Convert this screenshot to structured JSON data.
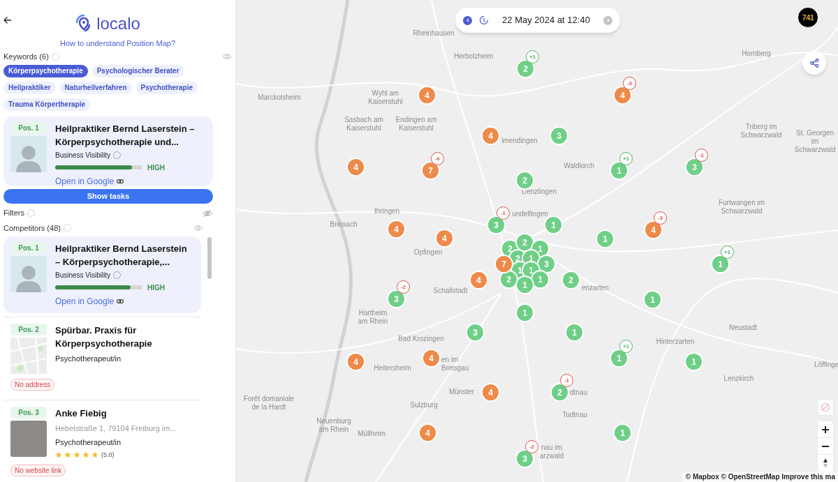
{
  "logo": "localo",
  "help_link": "How to understand Position Map?",
  "keywords": {
    "title": "Keywords (6)",
    "visible": true,
    "chips": [
      {
        "label": "Körperpsychotherapie",
        "selected": true
      },
      {
        "label": "Psychologischer Berater",
        "selected": false
      },
      {
        "label": "Heilpraktiker",
        "selected": false
      },
      {
        "label": "Naturheilverfahren",
        "selected": false
      },
      {
        "label": "Psychotherapie",
        "selected": false
      },
      {
        "label": "Trauma Körpertherapie",
        "selected": false
      }
    ]
  },
  "business": {
    "position": "Pos. 1",
    "thumbnail": {
      "kind": "portrait"
    },
    "title": "Heilpraktiker Bernd Laserstein – Körperpsychotherapie und...",
    "visibility_label": "Business Visibility",
    "level": 0.88,
    "visibility": "HIGH",
    "link": "Open in Google"
  },
  "show_tasks_button": "Show tasks",
  "filters": {
    "title": "Filters",
    "visible": false
  },
  "competitors": {
    "title": "Competitors (48)",
    "visible": true,
    "items": [
      {
        "position": "Pos. 1",
        "thumbnail": {
          "kind": "portrait"
        },
        "selected": true,
        "title": "Heilpraktiker Bernd Laserstein – Körperpsychotherapie,...",
        "visibility_label": "Business Visibility",
        "level": 0.86,
        "visibility": "HIGH",
        "link": "Open in Google"
      },
      {
        "position": "Pos. 2",
        "thumbnail": {
          "kind": "map"
        },
        "selected": false,
        "title": "Spürbar. Praxis für Körperpsychotherapie",
        "category": "Psychotherapeut/in",
        "tag": "No address"
      },
      {
        "position": "Pos. 3",
        "thumbnail": {
          "kind": "building"
        },
        "selected": false,
        "title": "Anke Fiebig",
        "address": "Hebelstraße 1, 79104 Freiburg im...",
        "category": "Psychotherapeut/in",
        "stars": 5,
        "rating": "(5.0)",
        "tag": "No website link"
      }
    ]
  },
  "date_picker": {
    "text": "22 May 2024 at 12:40",
    "prev_disabled": false,
    "next_disabled": true
  },
  "account_badge": "741",
  "map": {
    "places": [
      "Rheinhausen",
      "Herbolzheim",
      "Hornberg",
      "Marckolsheim",
      "Wyhl am Kaiserstuhl",
      "Sasbach am Kaiserstuhl",
      "Endingen am Kaiserstuhl",
      "imendingen",
      "Triberg im Schwarzwald",
      "St. Georgen im Schwarzwald",
      "Waldkirch",
      "Denzlingen",
      "Ihringen",
      "undelfingen",
      "Furtwangen im Schwarzwald",
      "Breisach",
      "Opfingen",
      "Schallstadt",
      "enzarten",
      "Hartheim am Rhein",
      "Neustadt",
      "Bad Krozingen",
      "Hinterzarten",
      "Heitersheim",
      "en im Breisgau",
      "Löffinge",
      "Lenzkirch",
      "Münster",
      "dtnau",
      "Forêt domaniale de la Hardt",
      "Sulzburg",
      "Todtnau",
      "Neuenburg am Rhein",
      "Müllheim",
      "nau im arzwald"
    ],
    "markers": [
      {
        "count": "2",
        "color": "#6fcf87",
        "badge": {
          "text": "+1",
          "color": "#4fb466"
        }
      },
      {
        "count": "4",
        "color": "#ee8a4a"
      },
      {
        "count": "4",
        "color": "#ee8a4a",
        "badge": {
          "text": "-3",
          "color": "#e0544c"
        }
      },
      {
        "count": "4",
        "color": "#ee8a4a"
      },
      {
        "count": "3",
        "color": "#6fcf87"
      },
      {
        "count": "4",
        "color": "#ee8a4a"
      },
      {
        "count": "7",
        "color": "#ee8a4a",
        "badge": {
          "text": "-6",
          "color": "#e0544c"
        }
      },
      {
        "count": "1",
        "color": "#6fcf87",
        "badge": {
          "text": "+1",
          "color": "#4fb466"
        }
      },
      {
        "count": "3",
        "color": "#6fcf87",
        "badge": {
          "text": "-1",
          "color": "#e0544c"
        }
      },
      {
        "count": "2",
        "color": "#6fcf87"
      },
      {
        "count": "4",
        "color": "#ee8a4a"
      },
      {
        "count": "4",
        "color": "#ee8a4a"
      },
      {
        "count": "3",
        "color": "#6fcf87",
        "badge": {
          "text": "-1",
          "color": "#e0544c"
        }
      },
      {
        "count": "1",
        "color": "#6fcf87"
      },
      {
        "count": "1",
        "color": "#6fcf87"
      },
      {
        "count": "4",
        "color": "#ee8a4a",
        "badge": {
          "text": "-3",
          "color": "#e0544c"
        }
      },
      {
        "count": "1",
        "color": "#6fcf87",
        "badge": {
          "text": "+1",
          "color": "#4fb466"
        }
      },
      {
        "count": "2",
        "color": "#6fcf87"
      },
      {
        "count": "2",
        "color": "#6fcf87"
      },
      {
        "count": "1",
        "color": "#6fcf87"
      },
      {
        "count": "2",
        "color": "#6fcf87"
      },
      {
        "count": "1",
        "color": "#6fcf87"
      },
      {
        "count": "3",
        "color": "#6fcf87"
      },
      {
        "count": "1",
        "color": "#6fcf87"
      },
      {
        "count": "1",
        "color": "#6fcf87"
      },
      {
        "count": "2",
        "color": "#6fcf87"
      },
      {
        "count": "1",
        "color": "#6fcf87"
      },
      {
        "count": "1",
        "color": "#6fcf87"
      },
      {
        "count": "7",
        "color": "#ee8a4a"
      },
      {
        "count": "4",
        "color": "#ee8a4a"
      },
      {
        "count": "2",
        "color": "#6fcf87"
      },
      {
        "count": "3",
        "color": "#6fcf87",
        "badge": {
          "text": "-2",
          "color": "#e0544c"
        }
      },
      {
        "count": "1",
        "color": "#6fcf87"
      },
      {
        "count": "1",
        "color": "#6fcf87"
      },
      {
        "count": "3",
        "color": "#6fcf87"
      },
      {
        "count": "1",
        "color": "#6fcf87"
      },
      {
        "count": "4",
        "color": "#ee8a4a"
      },
      {
        "count": "4",
        "color": "#ee8a4a"
      },
      {
        "count": "1",
        "color": "#6fcf87",
        "badge": {
          "text": "+1",
          "color": "#4fb466"
        }
      },
      {
        "count": "1",
        "color": "#6fcf87"
      },
      {
        "count": "4",
        "color": "#ee8a4a"
      },
      {
        "count": "2",
        "color": "#6fcf87",
        "badge": {
          "text": "-1",
          "color": "#e0544c"
        }
      },
      {
        "count": "4",
        "color": "#ee8a4a"
      },
      {
        "count": "1",
        "color": "#6fcf87"
      },
      {
        "count": "3",
        "color": "#6fcf87",
        "badge": {
          "text": "-2",
          "color": "#e0544c"
        }
      }
    ],
    "attribution": "© Mapbox © OpenStreetMap Improve this ma"
  }
}
